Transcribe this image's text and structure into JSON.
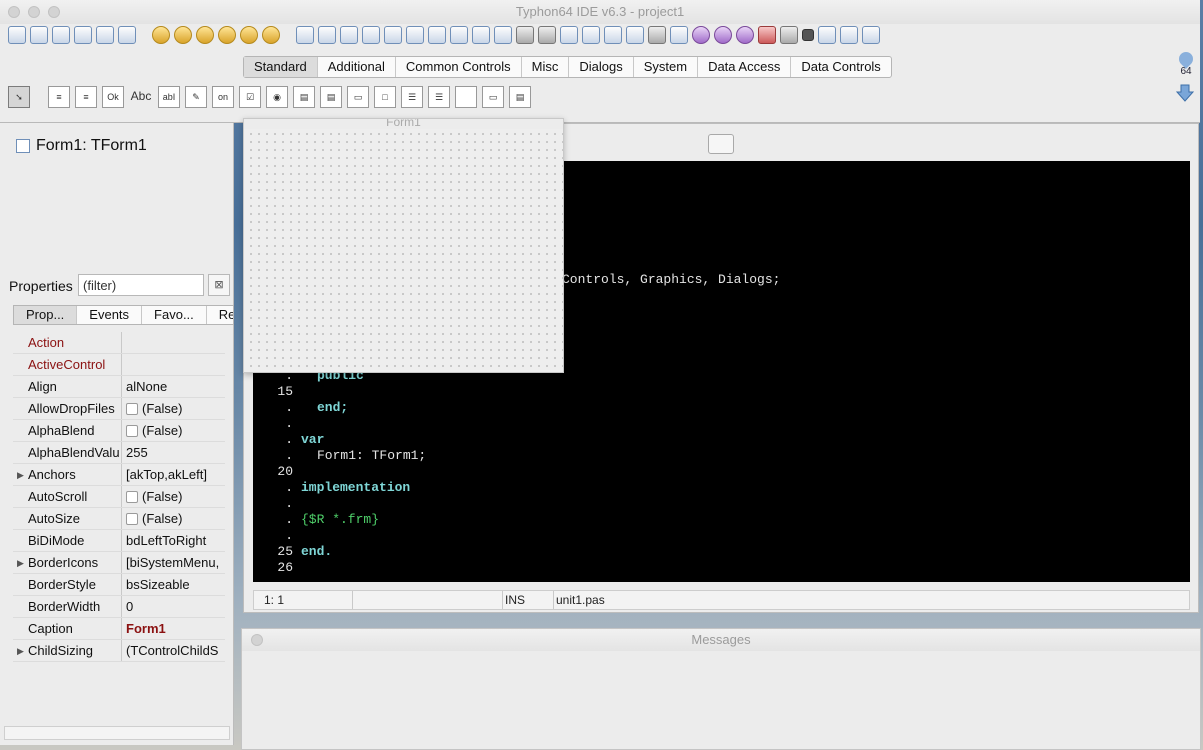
{
  "window": {
    "title": "Typhon64 IDE v6.3 - project1"
  },
  "palette": {
    "tabs": [
      "Standard",
      "Additional",
      "Common Controls",
      "Misc",
      "Dialogs",
      "System",
      "Data Access",
      "Data Controls"
    ],
    "active_tab": "Standard"
  },
  "components_bar": {
    "ok_label": "Ok",
    "abc_label": "Abc",
    "abi_label": "abI",
    "on_label": "on"
  },
  "badge": {
    "label": "64"
  },
  "component_tree": {
    "item": "Form1: TForm1"
  },
  "properties": {
    "label": "Properties",
    "filter_value": "(filter)",
    "tabs": [
      "Prop...",
      "Events",
      "Favo...",
      "Res"
    ],
    "rows": [
      {
        "name": "Action",
        "value": "",
        "kind": "event",
        "expandable": false
      },
      {
        "name": "ActiveControl",
        "value": "",
        "kind": "event",
        "expandable": false
      },
      {
        "name": "Align",
        "value": "alNone",
        "kind": "normal",
        "expandable": false
      },
      {
        "name": "AllowDropFiles",
        "value": "(False)",
        "kind": "check",
        "expandable": false
      },
      {
        "name": "AlphaBlend",
        "value": "(False)",
        "kind": "check",
        "expandable": false
      },
      {
        "name": "AlphaBlendValu",
        "value": "255",
        "kind": "normal",
        "expandable": false
      },
      {
        "name": "Anchors",
        "value": "[akTop,akLeft]",
        "kind": "normal",
        "expandable": true
      },
      {
        "name": "AutoScroll",
        "value": "(False)",
        "kind": "check",
        "expandable": false
      },
      {
        "name": "AutoSize",
        "value": "(False)",
        "kind": "check",
        "expandable": false
      },
      {
        "name": "BiDiMode",
        "value": "bdLeftToRight",
        "kind": "normal",
        "expandable": false
      },
      {
        "name": "BorderIcons",
        "value": "[biSystemMenu,",
        "kind": "normal",
        "expandable": true
      },
      {
        "name": "BorderStyle",
        "value": "bsSizeable",
        "kind": "normal",
        "expandable": false
      },
      {
        "name": "BorderWidth",
        "value": "0",
        "kind": "normal",
        "expandable": false
      },
      {
        "name": "Caption",
        "value": "Form1",
        "kind": "caption",
        "expandable": false
      },
      {
        "name": "ChildSizing",
        "value": "(TControlChildS",
        "kind": "normal",
        "expandable": true
      }
    ]
  },
  "editor": {
    "gutter": [
      ".",
      "15",
      ".",
      ".",
      ".",
      ".",
      "20",
      ".",
      ".",
      ".",
      ".",
      "25",
      "26"
    ],
    "lines": [
      {
        "text": "rms, Controls, Graphics, Dialogs;",
        "style": "plain",
        "indent": 0,
        "row": -6
      },
      {
        "text": "public",
        "style": "kw",
        "indent": 2,
        "row": 0
      },
      {
        "text": "end;",
        "style": "kw",
        "indent": 2,
        "row": 2
      },
      {
        "text": "var",
        "style": "kw",
        "indent": 0,
        "row": 4
      },
      {
        "text": "Form1: TForm1;",
        "style": "plain",
        "indent": 2,
        "row": 5
      },
      {
        "text": "implementation",
        "style": "kw",
        "indent": 0,
        "row": 7
      },
      {
        "text": "{$R *.frm}",
        "style": "cmt",
        "indent": 0,
        "row": 9
      },
      {
        "text": "end.",
        "style": "kw",
        "indent": 0,
        "row": 11
      }
    ],
    "status": {
      "position": "1: 1",
      "mode": "INS",
      "file": "unit1.pas"
    }
  },
  "form_designer": {
    "title": "Form1"
  },
  "messages": {
    "title": "Messages"
  }
}
